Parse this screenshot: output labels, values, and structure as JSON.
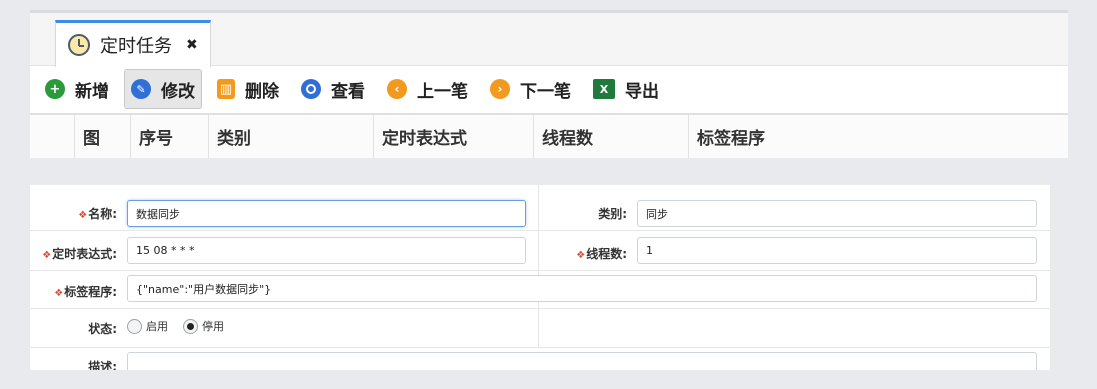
{
  "tab": {
    "label": "定时任务",
    "close": "✖"
  },
  "toolbar": {
    "add": "新增",
    "edit": "修改",
    "delete": "删除",
    "view": "查看",
    "prev": "上一笔",
    "next": "下一笔",
    "export": "导出"
  },
  "grid": {
    "columns": [
      "图",
      "序号",
      "类别",
      "定时表达式",
      "线程数",
      "标签程序"
    ]
  },
  "form": {
    "name": {
      "label": "名称:",
      "value": "数据同步",
      "required": true
    },
    "category": {
      "label": "类别:",
      "value": "同步"
    },
    "cron": {
      "label": "定时表达式:",
      "value": "15 08 * * *",
      "required": true
    },
    "threads": {
      "label": "线程数:",
      "value": "1",
      "required": true
    },
    "tag_program": {
      "label": "标签程序:",
      "value": "{\"name\":\"用户数据同步\"}",
      "required": true
    },
    "status": {
      "label": "状态:",
      "options": [
        "启用",
        "停用"
      ],
      "selected": "停用"
    },
    "description": {
      "label": "描述:",
      "value": ""
    }
  },
  "icons": {
    "tab": "clock-icon",
    "add": "plus-circle-icon",
    "edit": "pencil-icon",
    "delete": "trash-icon",
    "view": "eye-icon",
    "prev": "arrow-left-icon",
    "next": "arrow-right-icon",
    "export": "excel-icon"
  },
  "colors": {
    "add": "#2a9a3a",
    "edit": "#2f6fd6",
    "nav": "#f29a1f",
    "excel": "#1f7a3c",
    "required": "#e8452c",
    "tab_accent": "#3a8ee6"
  }
}
